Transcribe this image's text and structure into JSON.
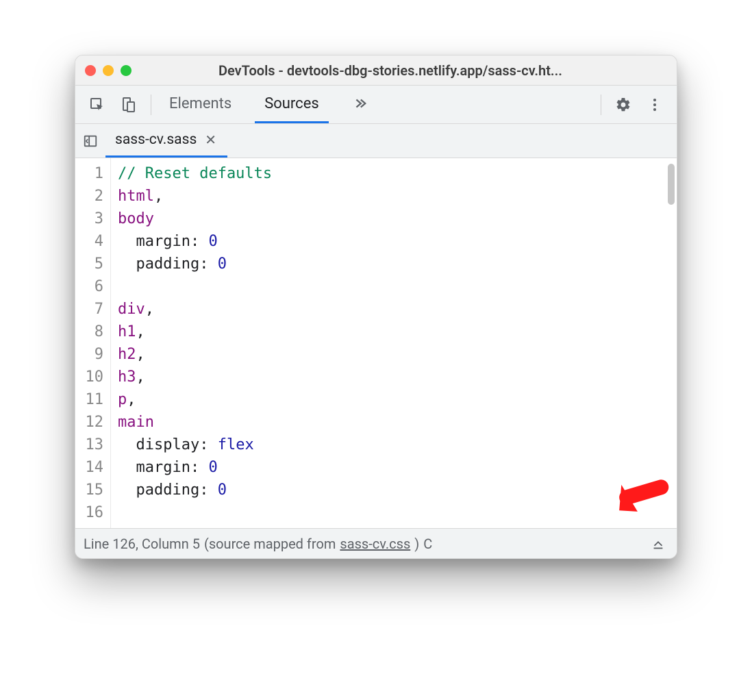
{
  "window": {
    "title": "DevTools - devtools-dbg-stories.netlify.app/sass-cv.ht..."
  },
  "toolbar": {
    "tabs": {
      "elements": "Elements",
      "sources": "Sources"
    }
  },
  "file_tab": {
    "name": "sass-cv.sass"
  },
  "editor": {
    "lines": [
      {
        "n": "1",
        "parts": [
          {
            "cls": "tok-comment",
            "t": "// Reset defaults"
          }
        ]
      },
      {
        "n": "2",
        "parts": [
          {
            "cls": "tok-selector",
            "t": "html"
          },
          {
            "cls": "tok-punct",
            "t": ","
          }
        ]
      },
      {
        "n": "3",
        "parts": [
          {
            "cls": "tok-selector",
            "t": "body"
          }
        ]
      },
      {
        "n": "4",
        "parts": [
          {
            "cls": "",
            "t": "  "
          },
          {
            "cls": "tok-prop",
            "t": "margin: "
          },
          {
            "cls": "tok-num",
            "t": "0"
          }
        ]
      },
      {
        "n": "5",
        "parts": [
          {
            "cls": "",
            "t": "  "
          },
          {
            "cls": "tok-prop",
            "t": "padding: "
          },
          {
            "cls": "tok-num",
            "t": "0"
          }
        ]
      },
      {
        "n": "6",
        "parts": []
      },
      {
        "n": "7",
        "parts": [
          {
            "cls": "tok-selector",
            "t": "div"
          },
          {
            "cls": "tok-punct",
            "t": ","
          }
        ]
      },
      {
        "n": "8",
        "parts": [
          {
            "cls": "tok-selector",
            "t": "h1"
          },
          {
            "cls": "tok-punct",
            "t": ","
          }
        ]
      },
      {
        "n": "9",
        "parts": [
          {
            "cls": "tok-selector",
            "t": "h2"
          },
          {
            "cls": "tok-punct",
            "t": ","
          }
        ]
      },
      {
        "n": "10",
        "parts": [
          {
            "cls": "tok-selector",
            "t": "h3"
          },
          {
            "cls": "tok-punct",
            "t": ","
          }
        ]
      },
      {
        "n": "11",
        "parts": [
          {
            "cls": "tok-selector",
            "t": "p"
          },
          {
            "cls": "tok-punct",
            "t": ","
          }
        ]
      },
      {
        "n": "12",
        "parts": [
          {
            "cls": "tok-selector",
            "t": "main"
          }
        ]
      },
      {
        "n": "13",
        "parts": [
          {
            "cls": "",
            "t": "  "
          },
          {
            "cls": "tok-prop",
            "t": "display: "
          },
          {
            "cls": "tok-kw",
            "t": "flex"
          }
        ]
      },
      {
        "n": "14",
        "parts": [
          {
            "cls": "",
            "t": "  "
          },
          {
            "cls": "tok-prop",
            "t": "margin: "
          },
          {
            "cls": "tok-num",
            "t": "0"
          }
        ]
      },
      {
        "n": "15",
        "parts": [
          {
            "cls": "",
            "t": "  "
          },
          {
            "cls": "tok-prop",
            "t": "padding: "
          },
          {
            "cls": "tok-num",
            "t": "0"
          }
        ]
      },
      {
        "n": "16",
        "parts": []
      }
    ]
  },
  "status": {
    "position": "Line 126, Column 5",
    "mapped_prefix": "(source mapped from ",
    "mapped_file": "sass-cv.css",
    "mapped_suffix": ")",
    "overflow": "C"
  }
}
